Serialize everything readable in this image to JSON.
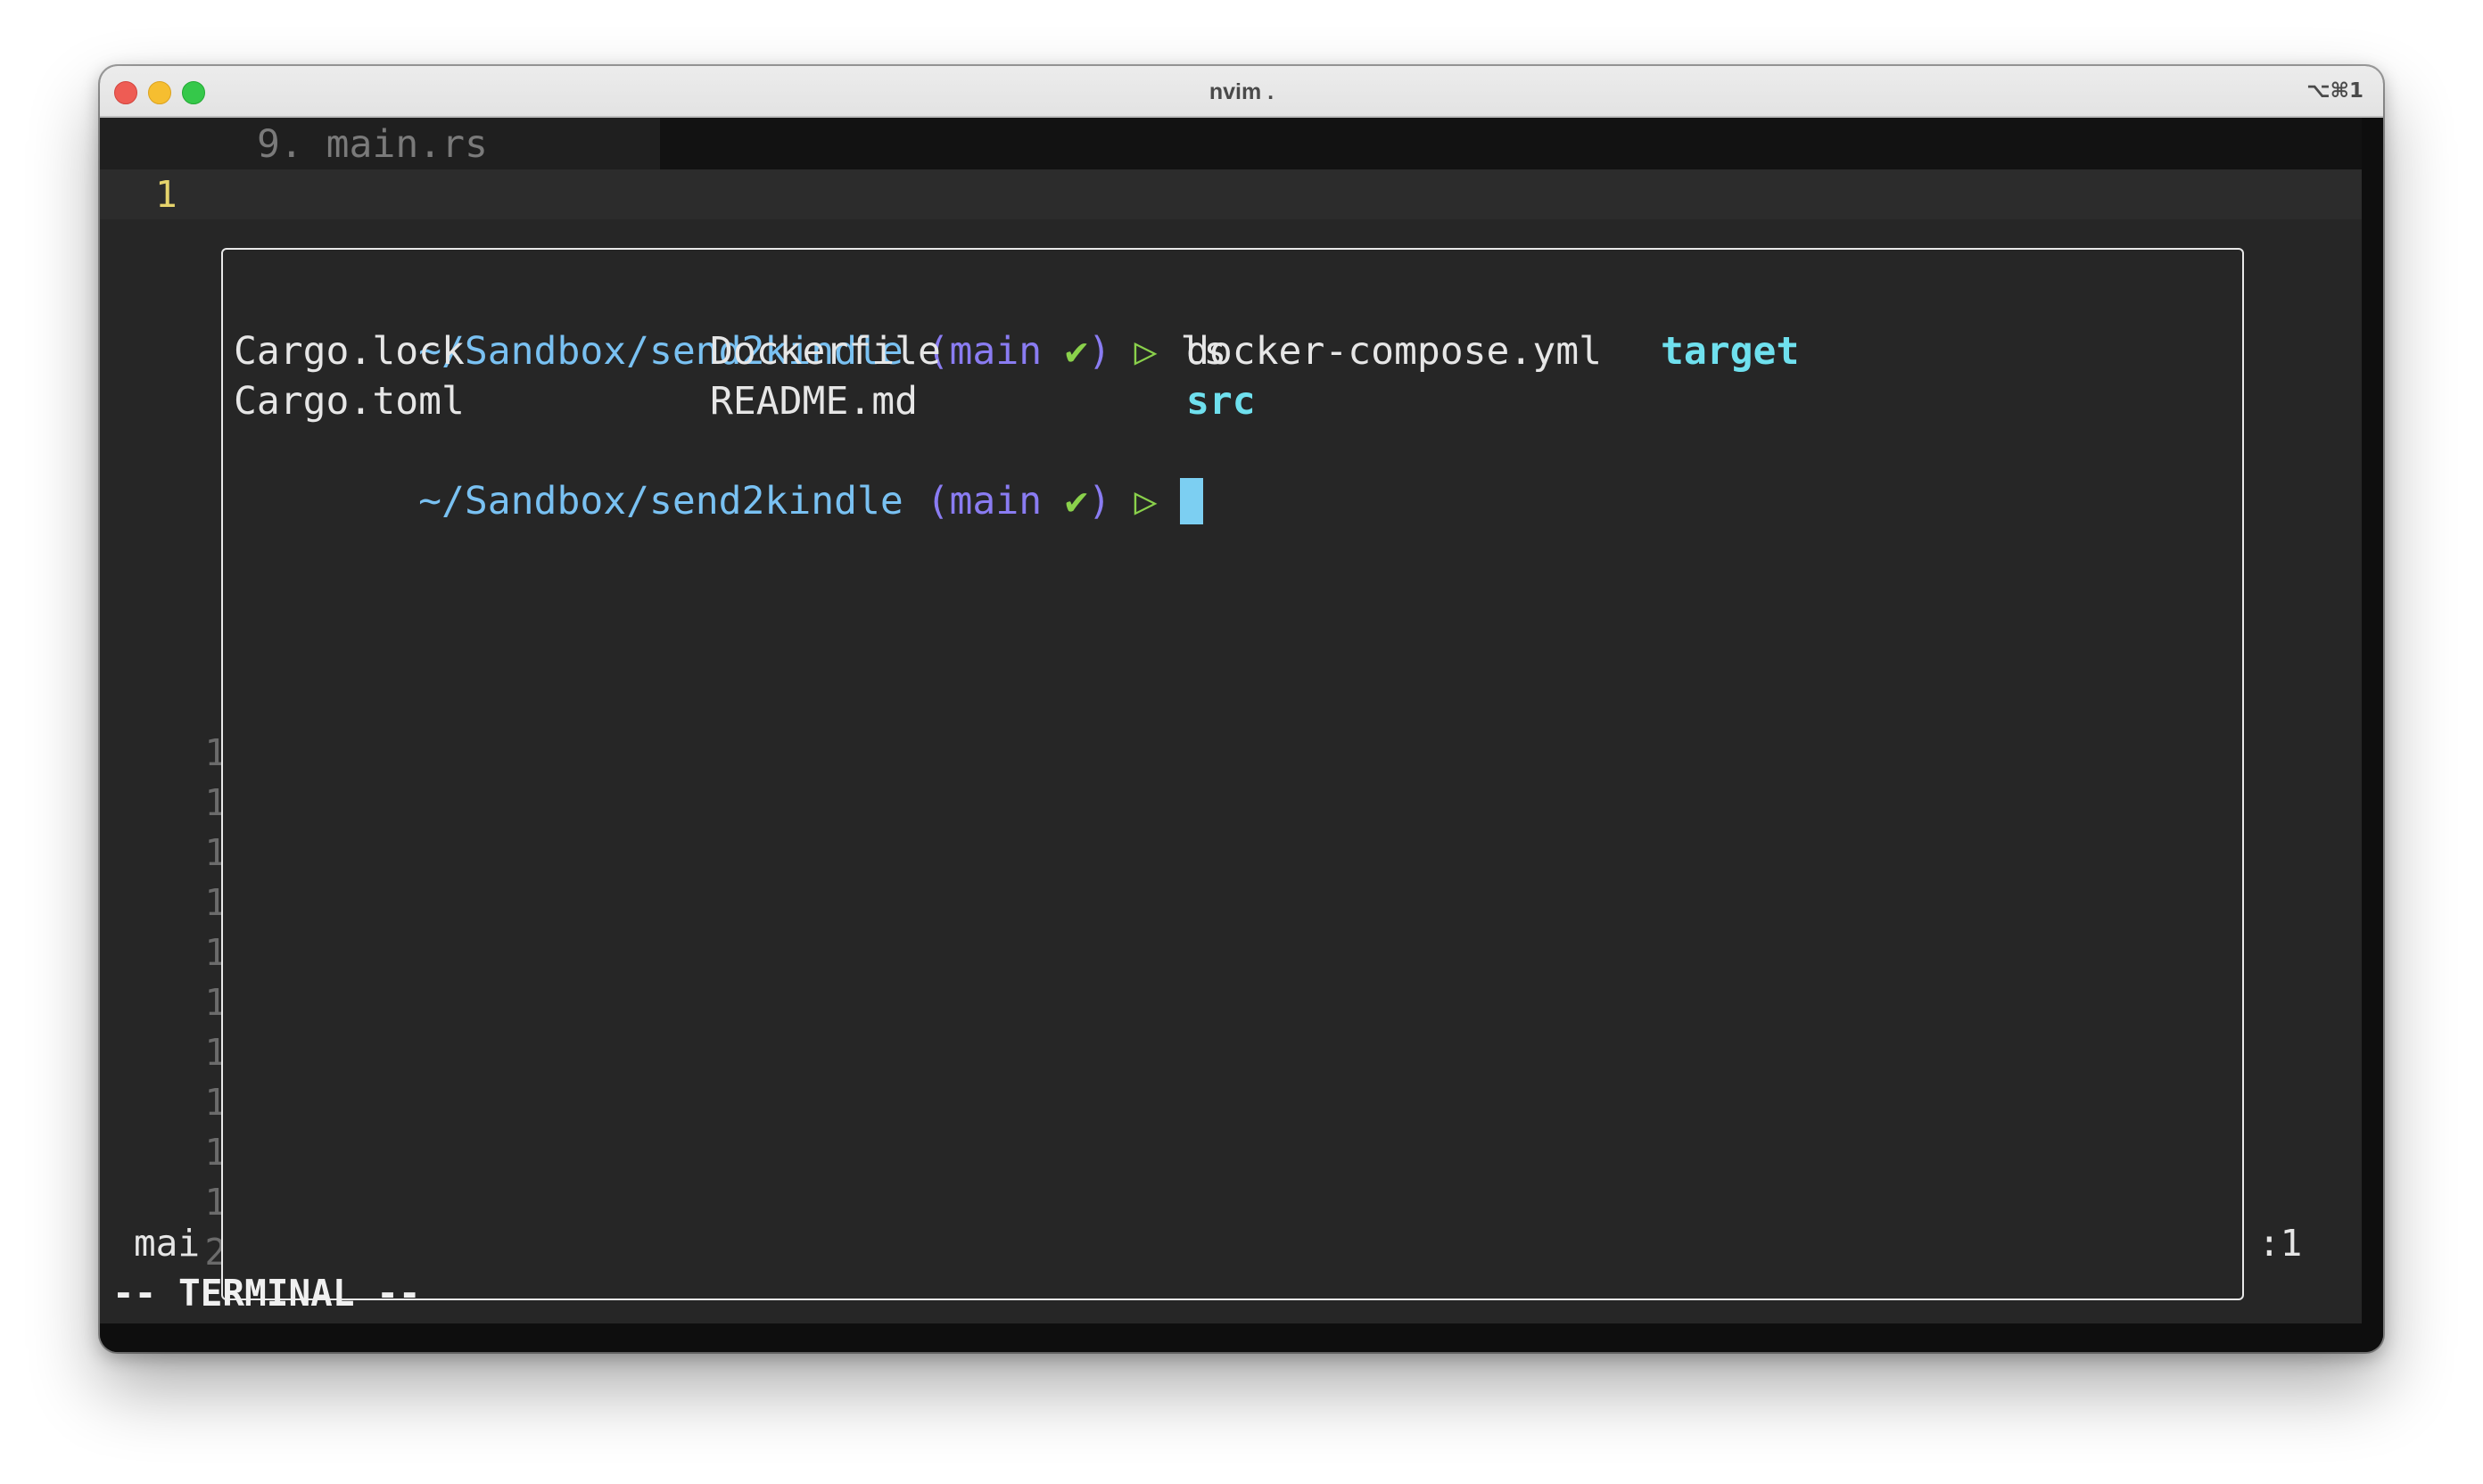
{
  "window": {
    "title": "nvim .",
    "shortcut": "⌥⌘1"
  },
  "tabline": {
    "tab_label": "9. main.rs"
  },
  "editor": {
    "current_line_number": "1",
    "relative_line_numbers": [
      "1",
      "1",
      "1",
      "1",
      "1",
      "1",
      "1",
      "1",
      "1",
      "1",
      "2"
    ]
  },
  "terminal": {
    "prompt1": {
      "path": "~/Sandbox/send2kindle",
      "branch_open": "(main",
      "check": "✔",
      "branch_close": ")",
      "arrow": "▷",
      "command": "ls"
    },
    "listing": {
      "row1": [
        "Cargo.lock",
        "Dockerfile",
        "docker-compose.yml",
        "target"
      ],
      "row2": [
        "Cargo.toml",
        "README.md",
        "src"
      ]
    },
    "prompt2": {
      "path": "~/Sandbox/send2kindle",
      "branch_open": "(main",
      "check": "✔",
      "branch_close": ")",
      "arrow": "▷"
    }
  },
  "statusline": {
    "left": "mai",
    "right": ":1"
  },
  "mode": "-- TERMINAL --",
  "colors": {
    "background": "#262626",
    "path": "#79c1f2",
    "branch": "#8a7cf2",
    "check": "#8ad14b",
    "directory": "#6fe0ee",
    "cursor": "#7ccff2",
    "current_line_number": "#e6d46c"
  }
}
